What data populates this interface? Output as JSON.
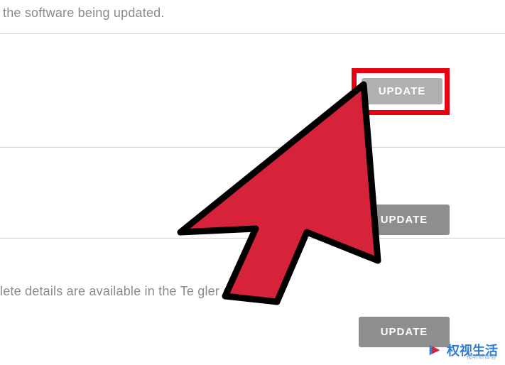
{
  "section1": {
    "description": "the software being updated."
  },
  "section2": {
    "update_label": "UPDATE"
  },
  "section3": {
    "update_label": "UPDATE"
  },
  "section4": {
    "description": "lete details are available in the Te             gler chan",
    "update_label": "UPDATE"
  },
  "watermark": {
    "text": "权视生活",
    "sub": "视听新体验"
  },
  "colors": {
    "highlight": "#e60012",
    "cursor_fill": "#d62339",
    "btn_bg": "#9e9e9e",
    "text_gray": "#8a8a8a"
  }
}
